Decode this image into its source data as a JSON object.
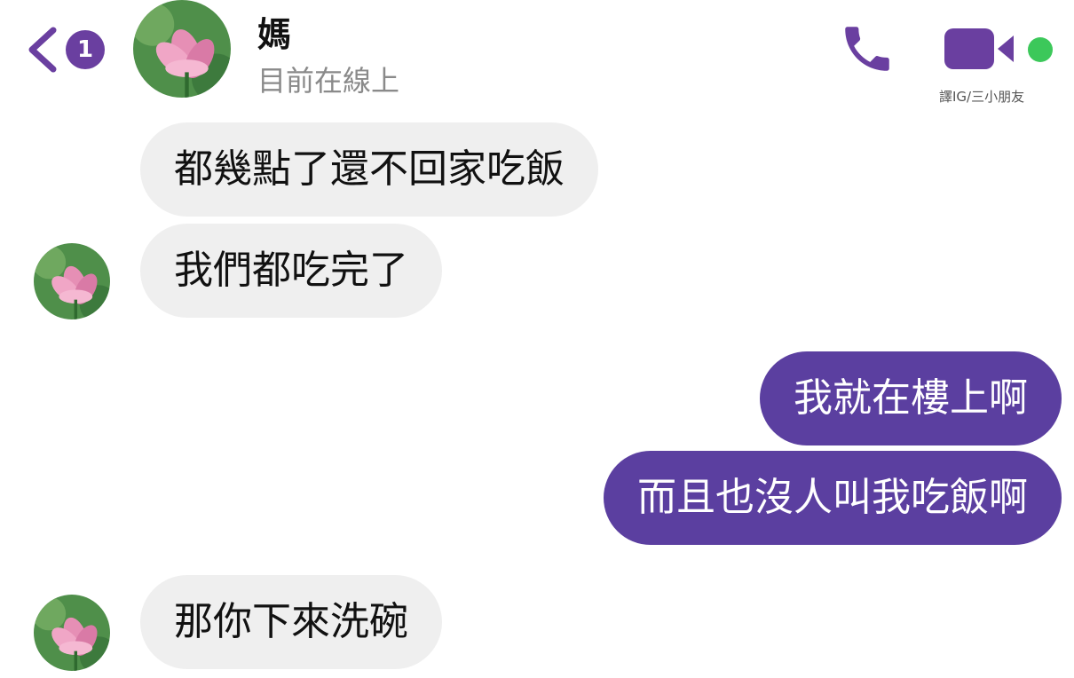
{
  "header": {
    "back_badge_count": "1",
    "contact_name": "媽",
    "contact_status": "目前在線上",
    "watermark": "譯IG/三小朋友",
    "back_icon": "chevron-left-icon",
    "call_icon": "phone-icon",
    "video_icon": "video-camera-icon"
  },
  "messages": [
    {
      "side": "received",
      "text": "都幾點了還不回家吃飯"
    },
    {
      "side": "received",
      "text": "我們都吃完了"
    },
    {
      "side": "sent",
      "text": "我就在樓上啊"
    },
    {
      "side": "sent",
      "text": "而且也沒人叫我吃飯啊"
    },
    {
      "side": "received",
      "text": "那你下來洗碗"
    }
  ],
  "colors": {
    "accent": "#6a3fa0",
    "sent_bubble": "#5b3fa0",
    "received_bubble": "#efefef",
    "online": "#3cc85a"
  }
}
